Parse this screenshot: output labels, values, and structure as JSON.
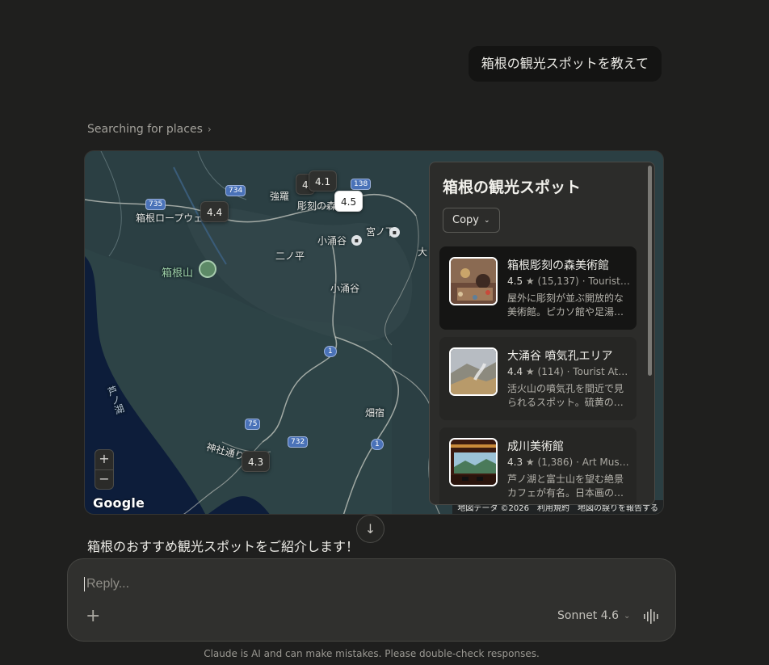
{
  "user_message": "箱根の観光スポットを教えて",
  "status": {
    "searching": "Searching for places"
  },
  "map": {
    "labels": {
      "gora": "強羅",
      "sculpture": "彫刻の森",
      "ropeway": "箱根ロープウェイ",
      "kowakudani_st": "小涌谷",
      "miyanoshita": "宮ノ下",
      "ninotaira": "二ノ平",
      "kowakudani": "小涌谷",
      "hakoneyama": "箱根山",
      "ashinoko": "芦ノ湖",
      "hatajuku": "畑宿",
      "jinja": "神社通り",
      "edge_dai": "大"
    },
    "routes": [
      "735",
      "734",
      "138",
      "1",
      "75",
      "732",
      "1"
    ],
    "pins": [
      "4.4",
      "4",
      "4.1",
      "4.5",
      "4.3"
    ],
    "zoom": {
      "in": "+",
      "out": "−"
    },
    "logo": "Google",
    "attribution": [
      "地図データ ©2026",
      "利用規約",
      "地図の誤りを報告する"
    ]
  },
  "panel": {
    "title": "箱根の観光スポット",
    "copy_label": "Copy",
    "places": [
      {
        "name": "箱根彫刻の森美術館",
        "rating": "4.5",
        "reviews": "(15,137)",
        "category": "Tourist …",
        "description": "屋外に彫刻が並ぶ開放的な美術館。ピカソ館や足湯…"
      },
      {
        "name": "大涌谷 噴気孔エリア",
        "rating": "4.4",
        "reviews": "(114)",
        "category": "Tourist Att…",
        "description": "活火山の噴気孔を間近で見られるスポット。硫黄の…"
      },
      {
        "name": "成川美術館",
        "rating": "4.3",
        "reviews": "(1,386)",
        "category": "Art Mus…",
        "description": "芦ノ湖と富士山を望む絶景カフェが有名。日本画の…"
      }
    ]
  },
  "assistant_intro": "箱根のおすすめ観光スポットをご紹介します！",
  "composer": {
    "placeholder": "Reply...",
    "model": "Sonnet 4.6"
  },
  "disclaimer": "Claude is AI and can make mistakes. Please double-check responses."
}
